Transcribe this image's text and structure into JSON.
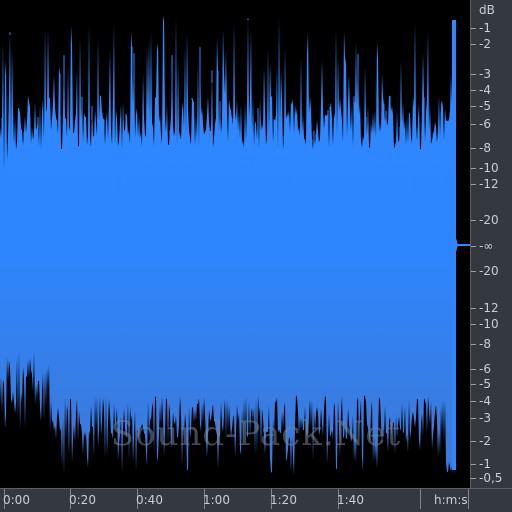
{
  "colors": {
    "background": "#000000",
    "waveform_top": "#2f86ff",
    "waveform_bottom": "#3c7fe0",
    "ruler_bg": "#343940",
    "ruler_text": "#c9ced4"
  },
  "db_scale": {
    "unit": "dB",
    "labels": [
      "-1",
      "-2",
      "-3",
      "-4",
      "-5",
      "-6",
      "-8",
      "-10",
      "-12",
      "-20",
      "-∞",
      "-20",
      "-12",
      "-10",
      "-8",
      "-6",
      "-5",
      "-4",
      "-3",
      "-2",
      "-1",
      "-0,5"
    ]
  },
  "time_ruler": {
    "labels": [
      "0:00",
      "0:20",
      "0:40",
      "1:00",
      "1:20",
      "1:40"
    ],
    "format_label": "h:m:s"
  },
  "watermark": "Sound-Pack.Net"
}
